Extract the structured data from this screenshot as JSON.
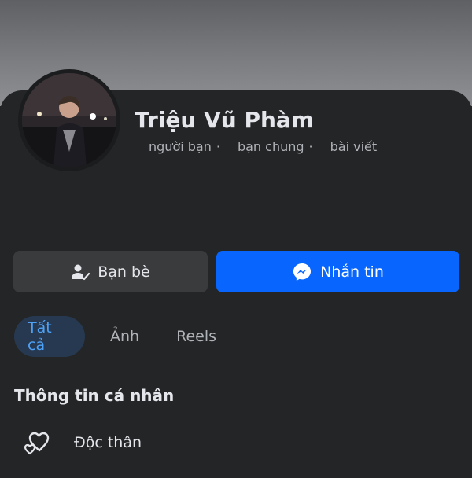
{
  "profile": {
    "name": "Triệu Vũ Phàm",
    "stats": [
      "người bạn",
      "bạn chung",
      "bài viết"
    ],
    "stat_separator": "·"
  },
  "actions": {
    "friends_label": "Bạn bè",
    "message_label": "Nhắn tin",
    "friends_icon": "friend-check-icon",
    "message_icon": "messenger-icon"
  },
  "tabs": [
    {
      "label": "Tất cả",
      "active": true
    },
    {
      "label": "Ảnh",
      "active": false
    },
    {
      "label": "Reels",
      "active": false
    }
  ],
  "personal_info": {
    "title": "Thông tin cá nhân",
    "items": [
      {
        "icon": "hearts-icon",
        "text": "Độc thân"
      }
    ]
  },
  "colors": {
    "background": "#242526",
    "primary_button": "#0866ff",
    "secondary_button": "#3a3b3c",
    "active_tab_bg": "#263951",
    "active_tab_text": "#4ea1f5"
  }
}
